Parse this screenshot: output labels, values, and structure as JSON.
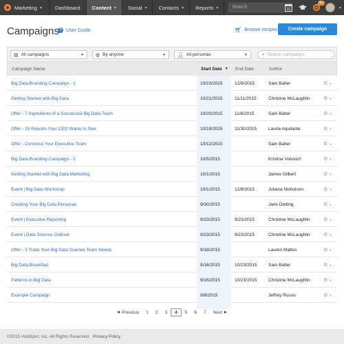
{
  "nav": {
    "brand": "Marketing",
    "items": [
      {
        "label": "Dashboard",
        "caret": false,
        "active": false
      },
      {
        "label": "Content",
        "caret": true,
        "active": true
      },
      {
        "label": "Social",
        "caret": true,
        "active": false
      },
      {
        "label": "Contacts",
        "caret": true,
        "active": false
      },
      {
        "label": "Reports",
        "caret": true,
        "active": false
      }
    ],
    "search_placeholder": "Search",
    "calendar_day": "31",
    "notification_badge": "9+",
    "accent_color": "#f5873c"
  },
  "header": {
    "title": "Campaigns",
    "user_guide": "User Guide",
    "browse_recipes": "Browse recipes",
    "create_campaign": "Create campaign"
  },
  "filters": {
    "campaigns": "All campaigns",
    "owner": "By anyone",
    "personas": "All personas",
    "search_placeholder": "Search campaigns"
  },
  "table": {
    "columns": {
      "name": "Campaign Name",
      "start": "Start Date",
      "end": "End Date",
      "author": "Author"
    },
    "rows": [
      {
        "name": "Big Data Branding Campaign - 1",
        "start": "10/23/2015",
        "end": "12/9/2015",
        "author": "Sam Balter"
      },
      {
        "name": "Getting Started with Big Data",
        "start": "10/21/2015",
        "end": "11/11/2015",
        "author": "Christine McLaughlin"
      },
      {
        "name": "Offer - 7 Ingredients of a Successful Big Data Team",
        "start": "10/20/2015",
        "end": "11/6/2015",
        "author": "Sam Balter"
      },
      {
        "name": "Offer - 15 Reports Your CEO Wants to See",
        "start": "10/19/2015",
        "end": "11/30/2015",
        "author": "Laurie Aquilante"
      },
      {
        "name": "Offer - Convince Your Executive Team",
        "start": "10/12/2015",
        "end": "",
        "author": "Sam Balter"
      },
      {
        "name": "Big Data Branding Campaign - 2",
        "start": "10/5/2015",
        "end": "",
        "author": "Kristina Volovich"
      },
      {
        "name": "Getting Started with Big Data Marketing",
        "start": "10/1/2015",
        "end": "",
        "author": "James Gilbert"
      },
      {
        "name": "Event | Big Data Workshop",
        "start": "10/1/2015",
        "end": "12/8/2015",
        "author": "Juliana Nicholson"
      },
      {
        "name": "Creating Your Big Data Personas",
        "start": "9/30/2015",
        "end": "",
        "author": "Jami Oetting"
      },
      {
        "name": "Event | Executive Reporting",
        "start": "9/23/2015",
        "end": "9/23/2015",
        "author": "Christine McLaughlin"
      },
      {
        "name": "Event | Data Science Outlook",
        "start": "9/23/2015",
        "end": "9/23/2015",
        "author": "Christine McLaughlin"
      },
      {
        "name": "Offer - 3 Traits Your Big Data Science Team Needs",
        "start": "9/18/2015",
        "end": "",
        "author": "Lauren Mattos"
      },
      {
        "name": "Big Data Breakfast",
        "start": "9/16/2015",
        "end": "10/23/2015",
        "author": "Sam Balter"
      },
      {
        "name": "Patterns in Big Data",
        "start": "9/16/2015",
        "end": "10/23/2015",
        "author": "Christine McLaughlin"
      },
      {
        "name": "Example Campaign",
        "start": "9/8/2015",
        "end": "",
        "author": "Jeffrey Russo"
      }
    ]
  },
  "pagination": {
    "previous": "Previous",
    "next": "Next",
    "pages": [
      "1",
      "2",
      "3",
      "4",
      "5",
      "6",
      "7"
    ],
    "current": "4"
  },
  "footer": {
    "copyright": "©2015 HubSpot, Inc. All Rights Reserved.",
    "privacy": "Privacy Policy"
  }
}
